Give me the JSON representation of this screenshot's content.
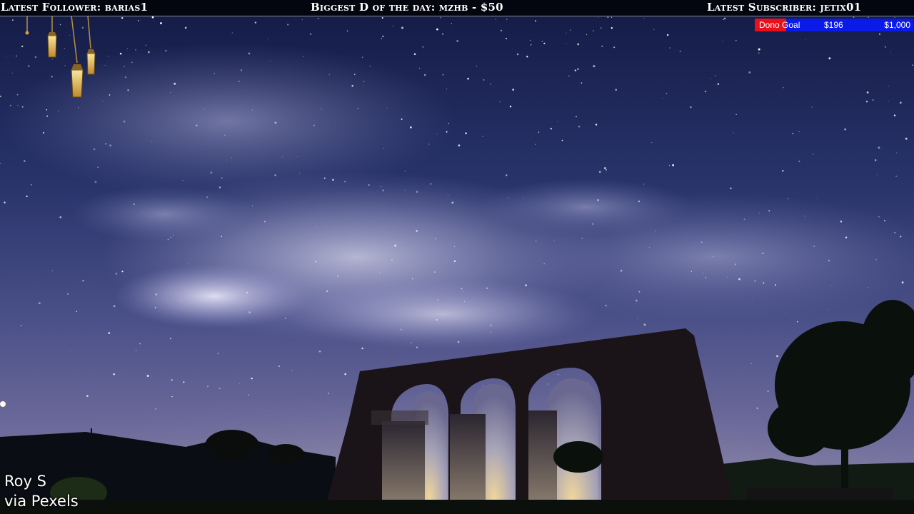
{
  "topbar": {
    "latest_follower": "Latest Follower: barias1",
    "biggest_donation": "Biggest D of the day: mzhb - $50",
    "latest_subscriber": "Latest Subscriber: jetix01"
  },
  "donation_goal": {
    "label": "Dono Goal",
    "current": "$196",
    "target": "$1,000",
    "progress": 0.196,
    "colors": {
      "filled": "#e8101a",
      "remaining": "#0a1ae8"
    }
  },
  "credit": {
    "author": "Roy S",
    "source": "via Pexels"
  },
  "scene_icons": [
    "hanging-lantern-icon",
    "stone-aqueduct-arches",
    "night-sky-stars"
  ]
}
